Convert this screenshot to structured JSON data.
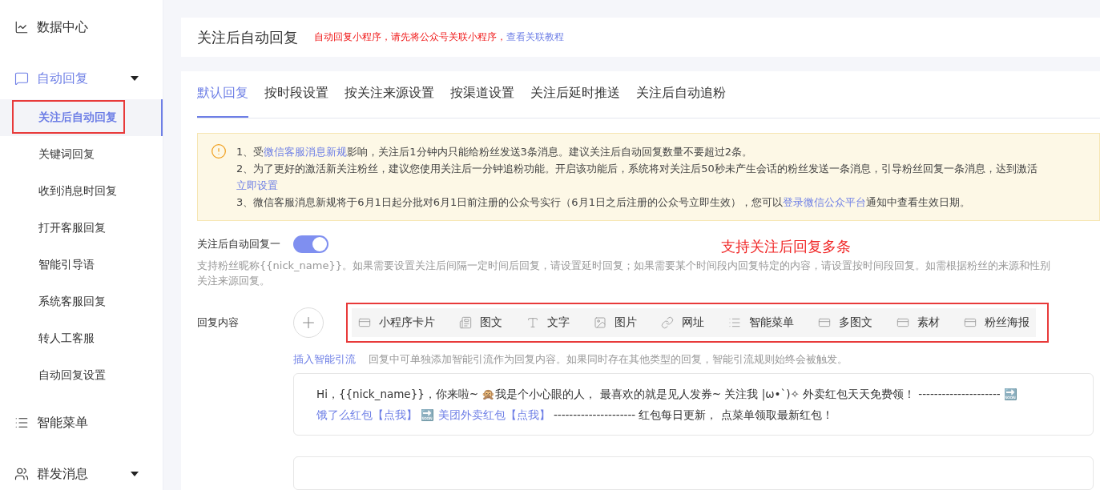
{
  "sidebar": {
    "items": [
      {
        "label": "数据中心",
        "kind": "chart",
        "selected": false
      },
      {
        "label": "自动回复",
        "kind": "message",
        "selected": true,
        "expanded": true,
        "children": [
          {
            "label": "关注后自动回复",
            "selected": true
          },
          {
            "label": "关键词回复",
            "selected": false
          },
          {
            "label": "收到消息时回复",
            "selected": false
          },
          {
            "label": "打开客服回复",
            "selected": false
          },
          {
            "label": "智能引导语",
            "selected": false
          },
          {
            "label": "系统客服回复",
            "selected": false
          },
          {
            "label": "转人工客服",
            "selected": false
          },
          {
            "label": "自动回复设置",
            "selected": false
          }
        ]
      },
      {
        "label": "智能菜单",
        "kind": "list",
        "selected": false
      },
      {
        "label": "群发消息",
        "kind": "users",
        "selected": false,
        "expanded": false
      }
    ]
  },
  "header": {
    "title": "关注后自动回复",
    "notice": "自动回复小程序，请先将公众号关联小程序，",
    "notice_link": "查看关联教程"
  },
  "tabs": [
    {
      "label": "默认回复",
      "selected": true
    },
    {
      "label": "按时段设置",
      "selected": false
    },
    {
      "label": "按关注来源设置",
      "selected": false
    },
    {
      "label": "按渠道设置",
      "selected": false
    },
    {
      "label": "关注后延时推送",
      "selected": false
    },
    {
      "label": "关注后自动追粉",
      "selected": false
    }
  ],
  "notice_box": {
    "lines": [
      [
        {
          "text": "1、受"
        },
        {
          "text": "微信客服消息新规",
          "link": true
        },
        {
          "text": "影响，关注后1分钟内只能给粉丝发送3条消息。建议关注后自动回复数量不要超过2条。"
        }
      ],
      [
        {
          "text": "2、为了更好的激活新关注粉丝，建议您使用关注后一分钟追粉功能。开启该功能后，系统将对关注后50秒未产生会话的粉丝发送一条消息，引导粉丝回复一条消息，达到激活"
        }
      ],
      [
        {
          "text": "立即设置",
          "link": true
        }
      ],
      [
        {
          "text": "3、微信客服消息新规将于6月1日起分批对6月1日前注册的公众号实行（6月1日之后注册的公众号立即生效），您可以"
        },
        {
          "text": "登录微信公众平台",
          "link": true
        },
        {
          "text": "通知中查看生效日期。"
        }
      ]
    ]
  },
  "reply_switch": {
    "label": "关注后自动回复一",
    "on": true
  },
  "annotation": "支持关注后回复多条",
  "hint_lines": [
    "支持粉丝昵称{{nick_name}}。如果需要设置关注后间隔一定时间后回复，请设置延时回复；如果需要某个时间段内回复特定的内容，请设置按时间段回复。如需根据粉丝的来源和性别",
    "关注来源回复。"
  ],
  "reply_content": {
    "label": "回复内容",
    "types": [
      {
        "label": "小程序卡片",
        "kind": "card"
      },
      {
        "label": "图文",
        "kind": "article"
      },
      {
        "label": "文字",
        "kind": "text"
      },
      {
        "label": "图片",
        "kind": "image"
      },
      {
        "label": "网址",
        "kind": "link"
      },
      {
        "label": "智能菜单",
        "kind": "list"
      },
      {
        "label": "多图文",
        "kind": "card"
      },
      {
        "label": "素材",
        "kind": "card"
      },
      {
        "label": "粉丝海报",
        "kind": "card"
      }
    ],
    "insert_link": "插入智能引流",
    "insert_hint": "回复中可单独添加智能引流作为回复内容。如果同时存在其他类型的回复，智能引流规则始终会被触发。"
  },
  "messages": [
    {
      "parts": [
        {
          "text": "Hi，{{nick_name}}，你来啦~ 🙊我是个小心眼的人， 最喜欢的就是见人发券~ 关注我 |ω•`)✧ 外卖红包天天免费领！ --------------------- 🔜 "
        },
        {
          "text": "饿了么红包【点我】",
          "link": true
        },
        {
          "text": " 🔜 "
        },
        {
          "text": "美团外卖红包【点我】",
          "link": true
        },
        {
          "text": " --------------------- 红包每日更新， 点菜单领取最新红包！"
        }
      ]
    }
  ]
}
